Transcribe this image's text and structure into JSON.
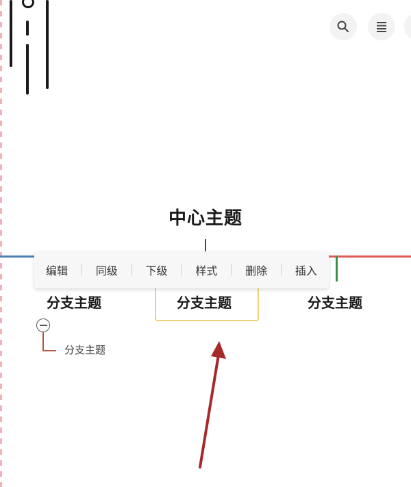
{
  "mindmap": {
    "center_topic": "中心主题",
    "branches": [
      {
        "label": "分支主题",
        "color": "#4a7fb5"
      },
      {
        "label": "分支主题",
        "color": "#e7c768",
        "selected": true
      },
      {
        "label": "分支主题",
        "color": "#3f8f4a"
      }
    ],
    "sub_topic": "分支主题",
    "right_line_color": "#e05a5a"
  },
  "toolbar": {
    "items": [
      "编辑",
      "同级",
      "下级",
      "样式",
      "删除",
      "插入"
    ]
  },
  "icons": {
    "top_right": [
      "search-icon",
      "list-icon"
    ]
  },
  "annotation": {
    "arrow_color": "#a52a2a"
  }
}
